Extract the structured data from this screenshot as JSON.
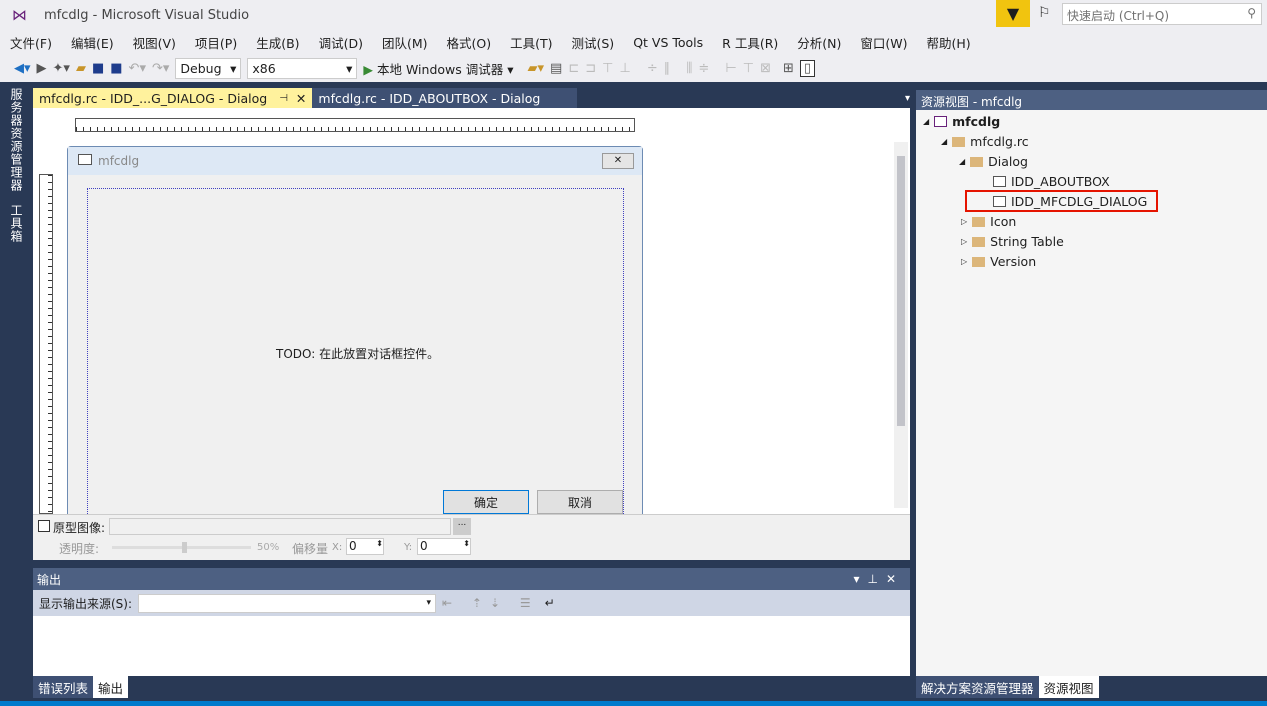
{
  "window": {
    "title": "mfcdlg - Microsoft Visual Studio",
    "quick_launch_placeholder": "快速启动 (Ctrl+Q)"
  },
  "menu": [
    "文件(F)",
    "编辑(E)",
    "视图(V)",
    "项目(P)",
    "生成(B)",
    "调试(D)",
    "团队(M)",
    "格式(O)",
    "工具(T)",
    "测试(S)",
    "Qt VS Tools",
    "R 工具(R)",
    "分析(N)",
    "窗口(W)",
    "帮助(H)"
  ],
  "toolbar": {
    "config": "Debug",
    "platform": "x86",
    "run_label": "本地 Windows 调试器"
  },
  "left_strip": [
    "服务器资源管理器",
    "工具箱"
  ],
  "doc_tabs": [
    {
      "label": "mfcdlg.rc - IDD_...G_DIALOG - Dialog",
      "active": true
    },
    {
      "label": "mfcdlg.rc - IDD_ABOUTBOX - Dialog",
      "active": false
    }
  ],
  "dialog": {
    "title": "mfcdlg",
    "todo": "TODO: 在此放置对话框控件。",
    "ok": "确定",
    "cancel": "取消"
  },
  "prototype": {
    "checkbox_label": "原型图像:",
    "opacity_label": "透明度:",
    "opacity_value": "50%",
    "opacity": 50,
    "offset_label": "偏移量",
    "x_label": "X:",
    "x_value": "0",
    "y_label": "Y:",
    "y_value": "0",
    "browse": "..."
  },
  "output": {
    "title": "输出",
    "source_label": "显示输出来源(S):",
    "source_value": ""
  },
  "bottom_tabs": [
    "错误列表",
    "输出"
  ],
  "resource_view": {
    "title": "资源视图 - mfcdlg",
    "tree": [
      {
        "label": "mfcdlg",
        "level": 0,
        "bold": true
      },
      {
        "label": "mfcdlg.rc",
        "level": 1
      },
      {
        "label": "Dialog",
        "level": 2
      },
      {
        "label": "IDD_ABOUTBOX",
        "level": 3
      },
      {
        "label": "IDD_MFCDLG_DIALOG",
        "level": 3,
        "highlighted": true
      },
      {
        "label": "Icon",
        "level": 2
      },
      {
        "label": "String Table",
        "level": 2
      },
      {
        "label": "Version",
        "level": 2
      }
    ]
  },
  "right_tabs": [
    "解决方案资源管理器",
    "资源视图"
  ],
  "colors": {
    "accent": "#007acc",
    "active_tab": "#fff29d",
    "frame": "#293955",
    "highlight_box": "#e51400"
  }
}
